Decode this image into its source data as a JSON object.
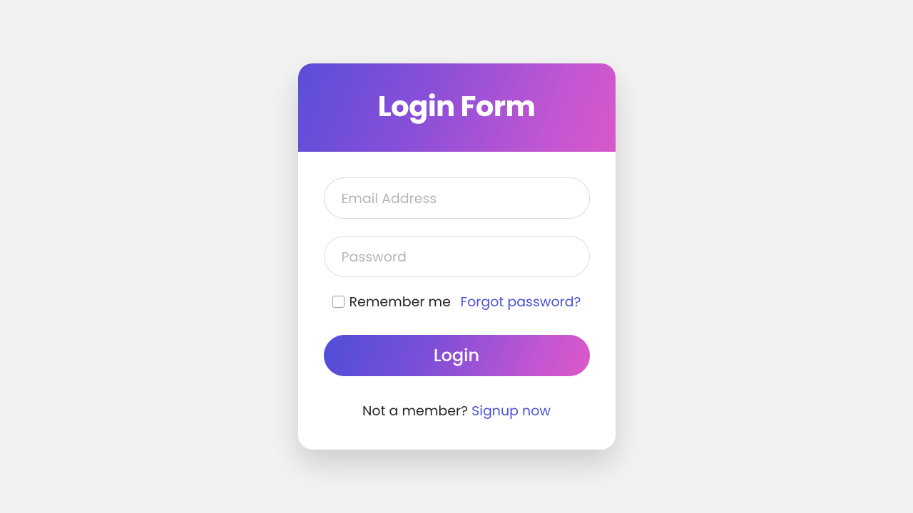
{
  "header": {
    "title": "Login Form"
  },
  "form": {
    "email_placeholder": "Email Address",
    "password_placeholder": "Password",
    "remember_label": "Remember me",
    "forgot_label": "Forgot password?",
    "login_button": "Login",
    "signup_prompt": "Not a member? ",
    "signup_link": "Signup now"
  },
  "colors": {
    "gradient_start": "#5a4ed8",
    "gradient_end": "#d858c9",
    "link": "#4a52d6",
    "bg": "#f2f2f2"
  }
}
